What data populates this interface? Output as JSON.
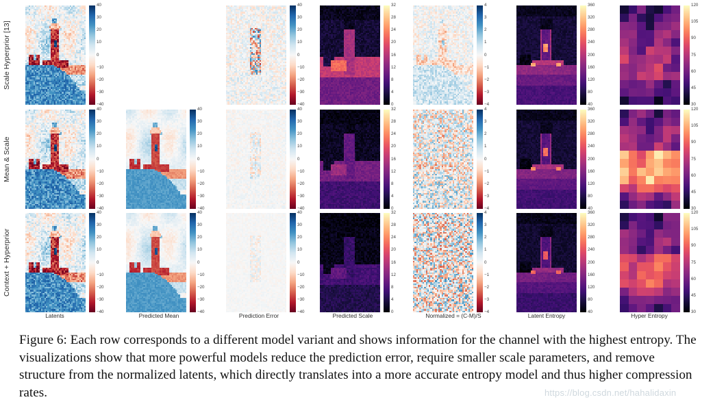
{
  "figure": {
    "label": "Figure 6:",
    "caption": "Each row corresponds to a different model variant and shows information for the channel with the highest entropy. The visualizations show that more powerful models reduce the prediction error, require smaller scale parameters, and remove structure from the normalized latents, which directly translates into a more accurate entropy model and thus higher compression rates.",
    "watermark": "https://blog.csdn.net/hahalidaxin"
  },
  "rows": [
    {
      "label": "Scale Hyperprior [13]"
    },
    {
      "label": "Mean & Scale"
    },
    {
      "label": "Context + Hyperprior"
    }
  ],
  "columns": [
    {
      "label": "Latents"
    },
    {
      "label": "Predicted Mean"
    },
    {
      "label": "Prediction Error"
    },
    {
      "label": "Predicted Scale"
    },
    {
      "label": "Normalized = (C-M)/S"
    },
    {
      "label": "Latent Entropy"
    },
    {
      "label": "Hyper Entropy"
    }
  ],
  "chart_data": {
    "type": "heatmap",
    "title": "Figure 6: per-channel latent visualizations across three model variants",
    "grid": {
      "rows": 3,
      "cols": 7
    },
    "row_names": [
      "Scale Hyperprior [13]",
      "Mean & Scale",
      "Context + Hyperprior"
    ],
    "col_names": [
      "Latents",
      "Predicted Mean",
      "Prediction Error",
      "Predicted Scale",
      "Normalized = (C-M)/S",
      "Latent Entropy",
      "Hyper Entropy"
    ],
    "empty_cells": [
      {
        "row": "Scale Hyperprior [13]",
        "col": "Predicted Mean"
      }
    ],
    "colorbars": [
      {
        "col": "Latents",
        "cmap": "RdBu",
        "ticks": [
          40,
          30,
          20,
          10,
          0,
          -10,
          -20,
          -30,
          -40
        ],
        "vmin": -40,
        "vmax": 40
      },
      {
        "col": "Predicted Mean",
        "cmap": "RdBu",
        "ticks": [
          40,
          30,
          20,
          10,
          0,
          -10,
          -20,
          -30,
          -40
        ],
        "vmin": -40,
        "vmax": 40
      },
      {
        "col": "Prediction Error",
        "cmap": "RdBu",
        "ticks": [
          40,
          30,
          20,
          10,
          0,
          -10,
          -20,
          -30,
          -40
        ],
        "vmin": -40,
        "vmax": 40
      },
      {
        "col": "Predicted Scale",
        "cmap": "magma",
        "ticks": [
          32,
          28,
          24,
          20,
          16,
          12,
          8,
          4,
          0
        ],
        "vmin": 0,
        "vmax": 32
      },
      {
        "col": "Normalized = (C-M)/S",
        "cmap": "RdBu",
        "ticks": [
          4,
          3,
          2,
          1,
          0,
          -1,
          -2,
          -3,
          -4
        ],
        "vmin": -4,
        "vmax": 4
      },
      {
        "col": "Latent Entropy",
        "cmap": "magma",
        "ticks": [
          360,
          320,
          280,
          240,
          200,
          160,
          120,
          80,
          40
        ],
        "vmin": 40,
        "vmax": 360
      },
      {
        "col": "Hyper Entropy",
        "cmap": "magma",
        "ticks": [
          120,
          105,
          90,
          75,
          60,
          45,
          30
        ],
        "vmin": 30,
        "vmax": 120
      }
    ],
    "notes": [
      "Latents and Predicted Mean show a lighthouse scene in a diverging red/blue colormap.",
      "Prediction Error becomes progressively flatter (closer to zero) from top row to bottom row.",
      "Predicted Scale magnitudes shrink for more powerful models.",
      "Normalized latents lose visible spatial structure in the Context + Hyperprior row.",
      "Hyper Entropy is rendered at a much coarser spatial resolution than Latent Entropy."
    ]
  }
}
